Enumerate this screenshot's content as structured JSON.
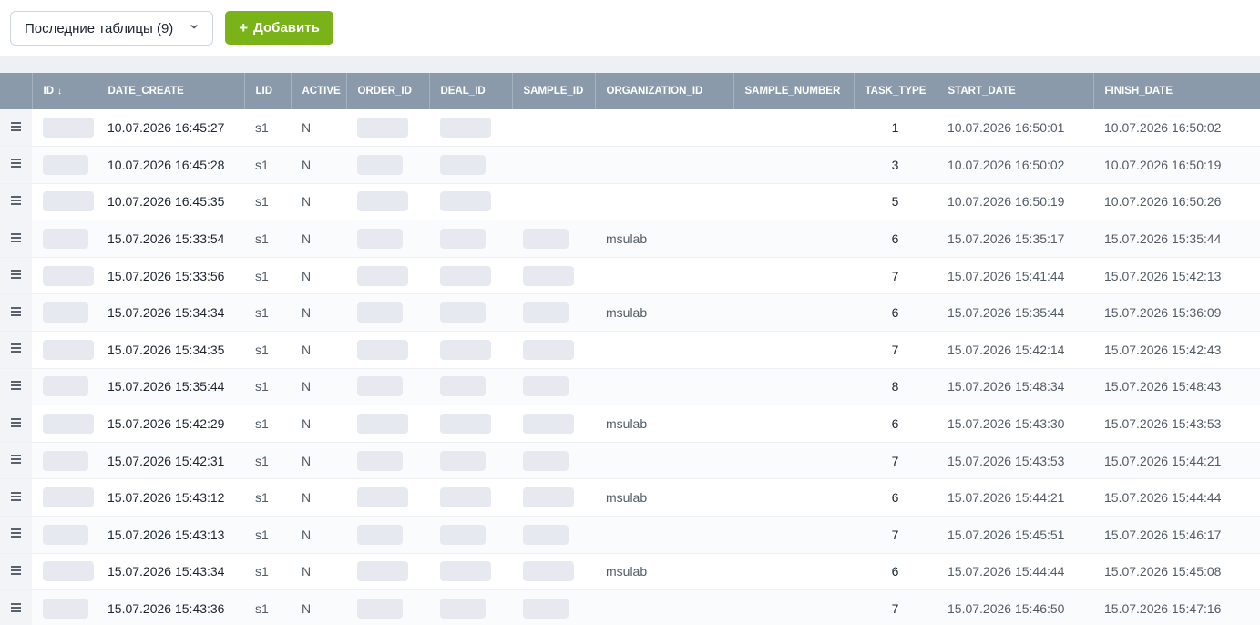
{
  "toolbar": {
    "recent_tables_label": "Последние таблицы (9)",
    "add_button_label": "Добавить",
    "add_icon": "plus-icon",
    "dropdown_icon": "chevron-down-icon"
  },
  "colors": {
    "accent_green": "#7ab317",
    "header_bg": "#8b9aab"
  },
  "table": {
    "sort_icon": "arrow-down-icon",
    "row_menu_icon": "burger-menu-icon",
    "columns": [
      "ID",
      "DATE_CREATE",
      "LID",
      "ACTIVE",
      "ORDER_ID",
      "DEAL_ID",
      "SAMPLE_ID",
      "ORGANIZATION_ID",
      "SAMPLE_NUMBER",
      "TASK_TYPE",
      "START_DATE",
      "FINISH_DATE"
    ],
    "rows": [
      {
        "date_create": "10.07.2026 16:45:27",
        "lid": "s1",
        "active": "N",
        "organization_id": "",
        "task_type": "1",
        "start_date": "10.07.2026 16:50:01",
        "finish_date": "10.07.2026 16:50:02"
      },
      {
        "date_create": "10.07.2026 16:45:28",
        "lid": "s1",
        "active": "N",
        "organization_id": "",
        "task_type": "3",
        "start_date": "10.07.2026 16:50:02",
        "finish_date": "10.07.2026 16:50:19"
      },
      {
        "date_create": "10.07.2026 16:45:35",
        "lid": "s1",
        "active": "N",
        "organization_id": "",
        "task_type": "5",
        "start_date": "10.07.2026 16:50:19",
        "finish_date": "10.07.2026 16:50:26"
      },
      {
        "date_create": "15.07.2026 15:33:54",
        "lid": "s1",
        "active": "N",
        "organization_id": "msulab",
        "task_type": "6",
        "start_date": "15.07.2026 15:35:17",
        "finish_date": "15.07.2026 15:35:44"
      },
      {
        "date_create": "15.07.2026 15:33:56",
        "lid": "s1",
        "active": "N",
        "organization_id": "",
        "task_type": "7",
        "start_date": "15.07.2026 15:41:44",
        "finish_date": "15.07.2026 15:42:13"
      },
      {
        "date_create": "15.07.2026 15:34:34",
        "lid": "s1",
        "active": "N",
        "organization_id": "msulab",
        "task_type": "6",
        "start_date": "15.07.2026 15:35:44",
        "finish_date": "15.07.2026 15:36:09"
      },
      {
        "date_create": "15.07.2026 15:34:35",
        "lid": "s1",
        "active": "N",
        "organization_id": "",
        "task_type": "7",
        "start_date": "15.07.2026 15:42:14",
        "finish_date": "15.07.2026 15:42:43"
      },
      {
        "date_create": "15.07.2026 15:35:44",
        "lid": "s1",
        "active": "N",
        "organization_id": "",
        "task_type": "8",
        "start_date": "15.07.2026 15:48:34",
        "finish_date": "15.07.2026 15:48:43"
      },
      {
        "date_create": "15.07.2026 15:42:29",
        "lid": "s1",
        "active": "N",
        "organization_id": "msulab",
        "task_type": "6",
        "start_date": "15.07.2026 15:43:30",
        "finish_date": "15.07.2026 15:43:53"
      },
      {
        "date_create": "15.07.2026 15:42:31",
        "lid": "s1",
        "active": "N",
        "organization_id": "",
        "task_type": "7",
        "start_date": "15.07.2026 15:43:53",
        "finish_date": "15.07.2026 15:44:21"
      },
      {
        "date_create": "15.07.2026 15:43:12",
        "lid": "s1",
        "active": "N",
        "organization_id": "msulab",
        "task_type": "6",
        "start_date": "15.07.2026 15:44:21",
        "finish_date": "15.07.2026 15:44:44"
      },
      {
        "date_create": "15.07.2026 15:43:13",
        "lid": "s1",
        "active": "N",
        "organization_id": "",
        "task_type": "7",
        "start_date": "15.07.2026 15:45:51",
        "finish_date": "15.07.2026 15:46:17"
      },
      {
        "date_create": "15.07.2026 15:43:34",
        "lid": "s1",
        "active": "N",
        "organization_id": "msulab",
        "task_type": "6",
        "start_date": "15.07.2026 15:44:44",
        "finish_date": "15.07.2026 15:45:08"
      },
      {
        "date_create": "15.07.2026 15:43:36",
        "lid": "s1",
        "active": "N",
        "organization_id": "",
        "task_type": "7",
        "start_date": "15.07.2026 15:46:50",
        "finish_date": "15.07.2026 15:47:16"
      }
    ]
  }
}
